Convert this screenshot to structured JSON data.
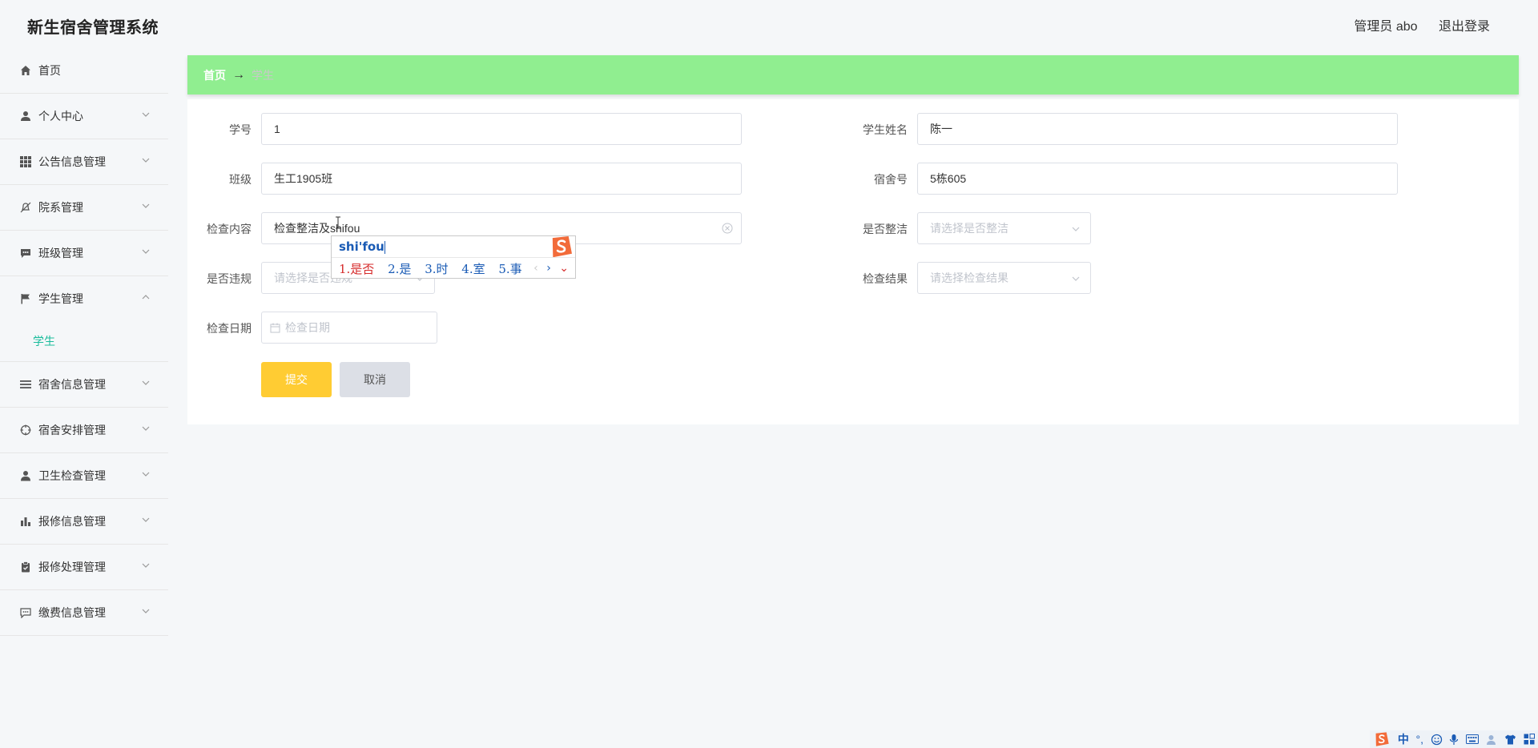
{
  "header": {
    "app_title": "新生宿舍管理系统",
    "user_label": "管理员 abo",
    "logout_label": "退出登录"
  },
  "sidebar": {
    "items": [
      {
        "label": "首页",
        "icon": "home-icon"
      },
      {
        "label": "个人中心",
        "icon": "user-icon"
      },
      {
        "label": "公告信息管理",
        "icon": "grid-icon"
      },
      {
        "label": "院系管理",
        "icon": "bell-off-icon"
      },
      {
        "label": "班级管理",
        "icon": "chat-icon"
      },
      {
        "label": "学生管理",
        "icon": "flag-icon",
        "expanded": true
      },
      {
        "label": "宿舍信息管理",
        "icon": "list-icon"
      },
      {
        "label": "宿舍安排管理",
        "icon": "crosshair-icon"
      },
      {
        "label": "卫生检查管理",
        "icon": "person-icon"
      },
      {
        "label": "报修信息管理",
        "icon": "bar-chart-icon"
      },
      {
        "label": "报修处理管理",
        "icon": "clipboard-icon"
      },
      {
        "label": "缴费信息管理",
        "icon": "message-icon"
      }
    ],
    "subitems": {
      "student": "学生"
    }
  },
  "breadcrumb": {
    "home": "首页",
    "separator": "→",
    "current": "学生"
  },
  "form": {
    "student_id": {
      "label": "学号",
      "value": "1"
    },
    "student_name": {
      "label": "学生姓名",
      "value": "陈一"
    },
    "class": {
      "label": "班级",
      "value": "生工1905班"
    },
    "dorm_no": {
      "label": "宿舍号",
      "value": "5栋605"
    },
    "check_content": {
      "label": "检查内容",
      "value": "检查整洁及shifou"
    },
    "is_clean": {
      "label": "是否整洁",
      "placeholder": "请选择是否整洁"
    },
    "is_violation": {
      "label": "是否违规",
      "placeholder": "请选择是否违规"
    },
    "check_result": {
      "label": "检查结果",
      "placeholder": "请选择检查结果"
    },
    "check_date": {
      "label": "检查日期",
      "placeholder": "检查日期"
    },
    "submit_label": "提交",
    "cancel_label": "取消"
  },
  "ime": {
    "pinyin": "shi'fou",
    "candidates": [
      "1.是否",
      "2.是",
      "3.时",
      "4.室",
      "5.事"
    ],
    "prev": "‹",
    "next": "›",
    "expand": "⌄"
  },
  "ime_tray": {
    "items": [
      "中",
      "°,"
    ]
  },
  "colors": {
    "breadcrumb_bg": "#90ee90",
    "submit_bg": "#ffcc33",
    "cancel_bg": "#dcdfe6",
    "active_submenu": "#1abc9c",
    "ime_logo": "#f26b3a"
  }
}
